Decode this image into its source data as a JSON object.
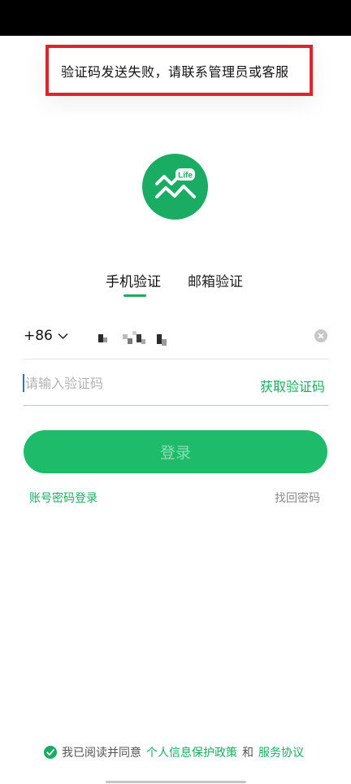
{
  "toast": {
    "message": "验证码发送失败，请联系管理员或客服"
  },
  "logo": {
    "badge": "Life",
    "color": "#1aac62"
  },
  "tabs": [
    {
      "label": "手机验证",
      "active": true
    },
    {
      "label": "邮箱验证",
      "active": false
    }
  ],
  "phone": {
    "country_code": "+86",
    "number_masked": true
  },
  "code": {
    "placeholder": "请输入验证码",
    "value": ""
  },
  "actions": {
    "get_code": "获取验证码",
    "login": "登录",
    "password_login": "账号密码登录",
    "find_password": "找回密码"
  },
  "agreement": {
    "checked": true,
    "prefix": "我已阅读并同意",
    "privacy_link": "个人信息保护政策",
    "and": "和",
    "terms_link": "服务协议"
  },
  "colors": {
    "accent": "#1aac62",
    "alert_border": "#d9252b"
  }
}
